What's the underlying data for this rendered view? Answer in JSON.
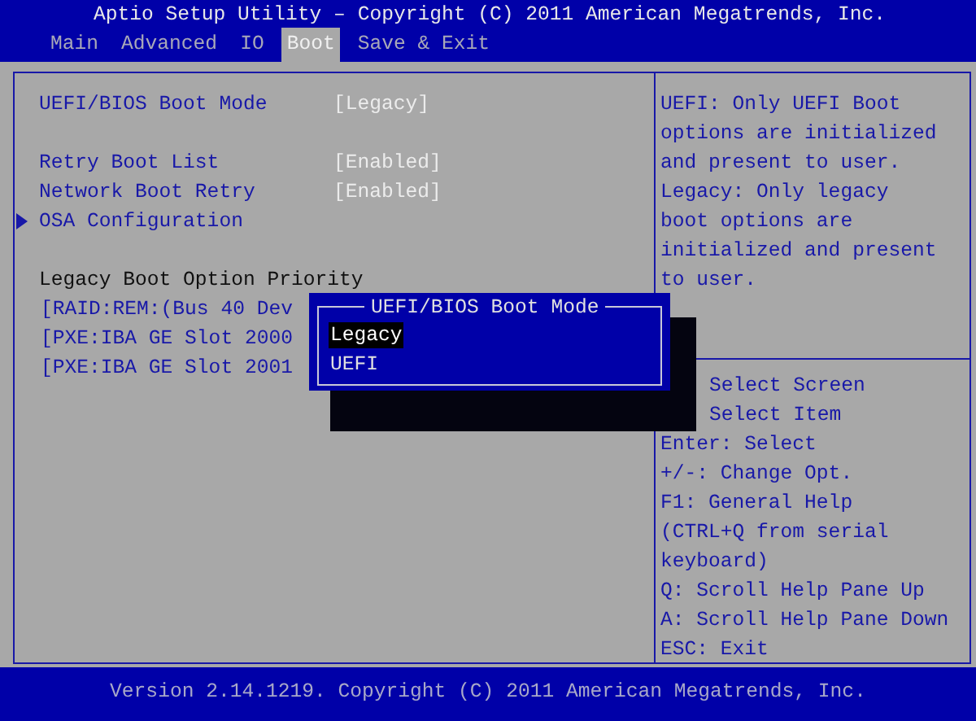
{
  "window": {
    "title": "Aptio Setup Utility – Copyright (C) 2011 American Megatrends, Inc."
  },
  "tabs": [
    {
      "label": "Main",
      "selected": false
    },
    {
      "label": "Advanced",
      "selected": false
    },
    {
      "label": "IO",
      "selected": false
    },
    {
      "label": "Boot",
      "selected": true
    },
    {
      "label": "Save & Exit",
      "selected": false
    }
  ],
  "settings": [
    [
      {
        "kind": "option",
        "label": "UEFI/BIOS Boot Mode",
        "value": "[Legacy]"
      }
    ],
    [
      {
        "kind": "option",
        "label": "Retry Boot List",
        "value": "[Enabled]"
      },
      {
        "kind": "option",
        "label": "Network Boot Retry",
        "value": "[Enabled]"
      },
      {
        "kind": "submenu",
        "label": "OSA Configuration"
      }
    ],
    [
      {
        "kind": "heading",
        "label": "Legacy Boot Option Priority"
      },
      {
        "kind": "entry",
        "label": "[RAID:REM:(Bus 40 Dev"
      },
      {
        "kind": "entry",
        "label": "[PXE:IBA GE Slot 2000"
      },
      {
        "kind": "entry",
        "label": "[PXE:IBA GE Slot 2001"
      }
    ]
  ],
  "help_text": [
    "UEFI: Only UEFI Boot",
    "options are initialized",
    "and present to user.",
    "Legacy: Only legacy",
    "boot options are",
    "initialized and present",
    "to user."
  ],
  "key_help": [
    {
      "kind": "arrow",
      "text": "Select Screen"
    },
    {
      "kind": "arrow",
      "text": "Select Item"
    },
    {
      "kind": "plain",
      "text": "Enter: Select"
    },
    {
      "kind": "plain",
      "text": "+/-: Change Opt."
    },
    {
      "kind": "plain",
      "text": "F1: General Help"
    },
    {
      "kind": "plain",
      "text": "(CTRL+Q from serial"
    },
    {
      "kind": "plain",
      "text": "keyboard)"
    },
    {
      "kind": "plain",
      "text": "Q: Scroll Help Pane Up"
    },
    {
      "kind": "plain",
      "text": "A: Scroll Help Pane Down"
    },
    {
      "kind": "plain",
      "text": "ESC: Exit"
    }
  ],
  "popup": {
    "title": "UEFI/BIOS Boot Mode",
    "options": [
      {
        "label": "Legacy",
        "selected": true
      },
      {
        "label": "UEFI",
        "selected": false
      }
    ]
  },
  "footer": "Version 2.14.1219. Copyright (C) 2011 American Megatrends, Inc."
}
